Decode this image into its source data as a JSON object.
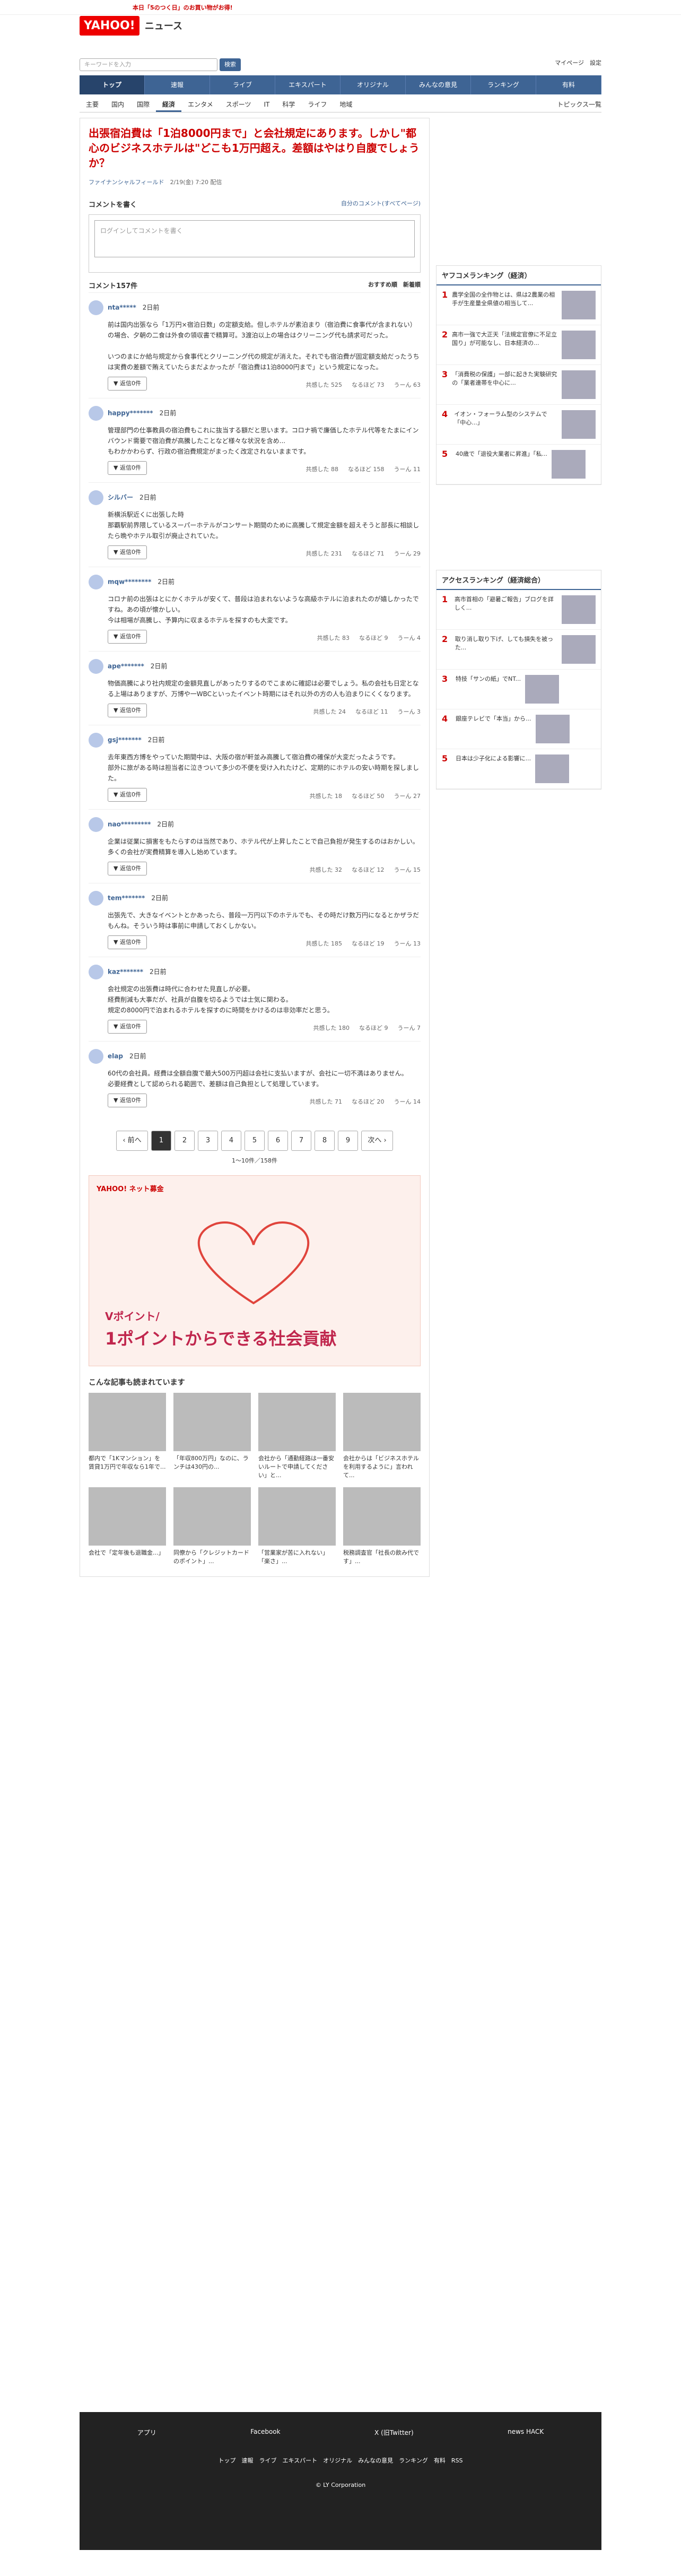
{
  "header": {
    "news_banner": "本日「5のつく日」のお買い物がお得!",
    "brand": "YAHOO!",
    "brand_sub": "ニュース",
    "search_placeholder": "キーワードを入力",
    "search_button": "検索",
    "topright": "マイページ　設定"
  },
  "nav": [
    "トップ",
    "速報",
    "ライブ",
    "エキスパート",
    "オリジナル",
    "みんなの意見",
    "ランキング",
    "有料"
  ],
  "subnav": [
    "主要",
    "国内",
    "国際",
    "経済",
    "エンタメ",
    "スポーツ",
    "IT",
    "科学",
    "ライフ",
    "地域"
  ],
  "subnav_right": "トピックス一覧",
  "article": {
    "headline": "出張宿泊費は「1泊8000円まで」と会社規定にあります。しかし\"都心のビジネスホテルは\"どこも1万円超え。差額はやはり自腹でしょうか？",
    "source": "ファイナンシャルフィールド",
    "date": "2/19(金) 7:20 配信"
  },
  "compose": {
    "title": "コメントを書く",
    "link": "自分のコメント(すべてページ)",
    "placeholder": "ログインしてコメントを書く"
  },
  "comments": {
    "count_label": "コメント157件",
    "sort": "おすすめ順　新着順",
    "items": [
      {
        "user": "nta*****",
        "time": "2日前",
        "text": "前は国内出張なら「1万円×宿泊日数」の定額支給。但しホテルが素泊まり（宿泊費に食事代が含まれない）の場合、夕朝の二食は外食の領収書で精算可。3渡泊以上の場合はクリーニング代も請求可だった。\n\nいつのまにか給与規定から食事代とクリーニング代の規定が消えた。それでも宿泊費が固定額支給だったうちは実費の差額で賄えていたらまだよかったが「宿泊費は1泊8000円まで」という規定になった。",
        "likes": "525",
        "meh": "73",
        "bad": "63"
      },
      {
        "user": "happy*******",
        "time": "2日前",
        "text": "管理部門の仕事教員の宿泊費もこれに抜当する額だと思います。コロナ禍で廉価したホテル代等をたまにインバウンド需要で宿泊費が高騰したことなど様々な状況を含め...\nもわかかわらず、行政の宿泊費規定がまったく改定されないままです。",
        "likes": "88",
        "meh": "158",
        "bad": "11"
      },
      {
        "user": "シルバー",
        "time": "2日前",
        "text": "新横浜駅近くに出張した時\n那覇駅前界隈しているスーパーホテルがコンサート期間のために高騰して規定金額を超えそうと部長に相談したら晩やホテル取引が廃止されていた。",
        "likes": "231",
        "meh": "71",
        "bad": "29"
      },
      {
        "user": "mqw********",
        "time": "2日前",
        "text": "コロナ前の出張はとにかくホテルが安くて、普段は泊まれないような高級ホテルに泊まれたのが嬉しかったですね。あの頃が懐かしい。\n今は相場が高騰し、予算内に収まるホテルを探すのも大変です。",
        "likes": "83",
        "meh": "9",
        "bad": "4"
      },
      {
        "user": "ape*******",
        "time": "2日前",
        "text": "物価高騰により社内規定の金額見直しがあったりするのでこまめに確認は必要でしょう。私の会社も日定となる上場はありますが、万博や一WBCといったイベント時期にはそれ以外の方の人も泊まりにくくなります。",
        "likes": "24",
        "meh": "11",
        "bad": "3"
      },
      {
        "user": "gsj*******",
        "time": "2日前",
        "text": "去年東西方博をやっていた期間中は、大阪の宿が軒並み高騰して宿泊費の確保が大変だったようです。\n部外に旅がある時は担当者に泣きついて多少の不便を受け入れたけど、定期的にホテルの安い時期を探しました。",
        "likes": "18",
        "meh": "50",
        "bad": "27"
      },
      {
        "user": "nao*********",
        "time": "2日前",
        "text": "企業は従業に損害をもたらすのは当然であり、ホテル代が上昇したことで自己負担が発生するのはおかしい。\n多くの会社が実費精算を導入し始めています。",
        "likes": "32",
        "meh": "12",
        "bad": "15"
      },
      {
        "user": "tem*******",
        "time": "2日前",
        "text": "出張先で、大きなイベントとかあったら、普段一万円以下のホテルでも、その時だけ数万円になるとかザラだもんね。そういう時は事前に申請しておくしかない。",
        "likes": "185",
        "meh": "19",
        "bad": "13"
      },
      {
        "user": "kaz*******",
        "time": "2日前",
        "text": "会社規定の出張費は時代に合わせた見直しが必要。\n経費削減も大事だが、社員が自腹を切るようでは士気に関わる。\n規定の8000円で泊まれるホテルを探すのに時間をかけるのは非効率だと思う。",
        "likes": "180",
        "meh": "9",
        "bad": "7"
      },
      {
        "user": "elap",
        "time": "2日前",
        "text": "60代の会社員。経費は全額自腹で最大500万円超は会社に支払いますが、会社に一切不満はありません。\n必要経費として認められる範囲で、差額は自己負担として処理しています。",
        "likes": "71",
        "meh": "20",
        "bad": "14"
      }
    ],
    "reply_label": "▼ 返信0件",
    "vote_like": "共感した",
    "vote_meh": "なるほど",
    "vote_bad": "うーん"
  },
  "pager": {
    "prev": "‹ 前へ",
    "pages": [
      "1",
      "2",
      "3",
      "4",
      "5",
      "6",
      "7",
      "8",
      "9"
    ],
    "next": "次へ ›",
    "summary": "1〜10件／158件"
  },
  "ad": {
    "brand": "YAHOO! ネット募金",
    "tagline": "1ポイントからできる社会貢献",
    "sub": "Vポイント/"
  },
  "recommend": {
    "title": "こんな記事も読まれています",
    "items": [
      "都内で「1Kマンション」を賃貸1万円で年収なら1年で...",
      "「年収800万円」なのに、ランチは430円の...",
      "会社から「通勤経路は一番安いルートで申請してください」と...",
      "会社からは「ビジネスホテルを利用するように」言われて...",
      "会社で「定年後も退職金...」",
      "同僚から「クレジットカードのポイント」...",
      "「営業家が苦に入れない」「楽さ」...",
      "税務調査官「社長の飲み代です」..."
    ]
  },
  "sidebar": {
    "rank_title": "ヤフコメランキング（経済）",
    "ranking": [
      {
        "n": "1",
        "t": "農学全国の全作物とは、県は2農業の相手が生産量全県値の相当して..."
      },
      {
        "n": "2",
        "t": "高市一強で大正天「法規定官僚に不足立国り」が可能なし、日本経済の..."
      },
      {
        "n": "3",
        "t": "「消費税の保護」一部に起きた実験研究の「業者連帯を中心に..."
      },
      {
        "n": "4",
        "t": "イオン・フォーラム型のシステムで「中心...」"
      },
      {
        "n": "5",
        "t": "40歳で「退役大業者に昇進」「私..."
      }
    ],
    "access_title": "アクセスランキング（経済総合）",
    "access": [
      {
        "n": "1",
        "t": "高市首相の「避暑ご報告」ブログを詳しく..."
      },
      {
        "n": "2",
        "t": "取り消し取り下げ、しても損失を被った..."
      },
      {
        "n": "3",
        "t": "特技「サンの紙」でNT..."
      },
      {
        "n": "4",
        "t": "銀座テレビで「本当」から..."
      },
      {
        "n": "5",
        "t": "日本は少子化による影響に..."
      }
    ]
  },
  "footer": {
    "apps": [
      "アプリ",
      "Facebook",
      "X (旧Twitter)",
      "news HACK"
    ],
    "links": "トップ　速報　ライブ　エキスパート　オリジナル　みんなの意見　ランキング　有料　RSS",
    "copyright": "© LY Corporation"
  }
}
